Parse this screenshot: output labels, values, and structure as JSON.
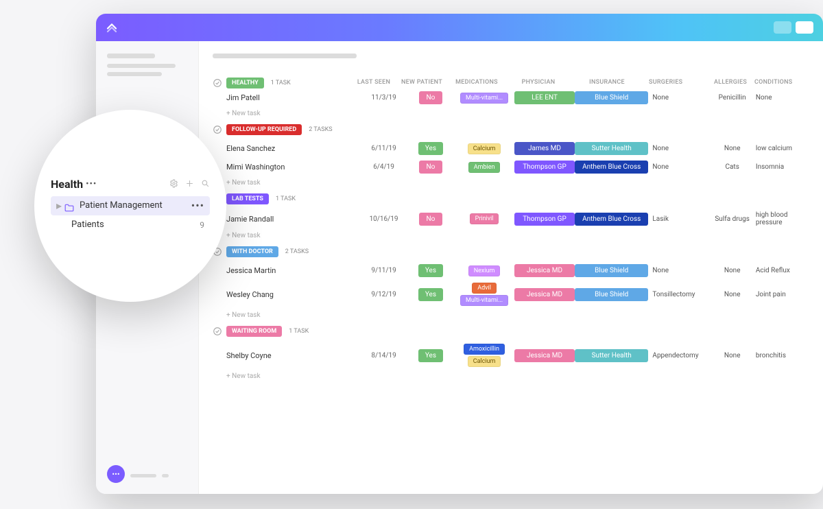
{
  "sidebar_magnifier": {
    "space_title": "Health",
    "folder_label": "Patient Management",
    "list_label": "Patients",
    "list_count": "9"
  },
  "columns": {
    "last_seen": "LAST SEEN",
    "new_patient": "NEW PATIENT",
    "medications": "MEDICATIONS",
    "physician": "PHYSICIAN",
    "insurance": "INSURANCE",
    "surgeries": "SURGERIES",
    "allergies": "ALLERGIES",
    "conditions": "CONDITIONS"
  },
  "labels": {
    "new_task": "+ New task"
  },
  "colors": {
    "new_yes": "#6fbf73",
    "new_no": "#ec7aa6"
  },
  "physician_colors": {
    "LEE ENT": "#6fbf73",
    "James MD": "#4a56c7",
    "Thompson GP": "#7f57ff",
    "Jessica MD": "#ec7aa6"
  },
  "insurance_colors": {
    "Blue Shield": "#5fa8e6",
    "Sutter Health": "#5fc1c7",
    "Anthem Blue Cross": "#1a3fb0"
  },
  "med_colors": {
    "Multi-vitami...": "#b18cff",
    "Calcium": "#f2c94c",
    "Ambien": "#6fbf73",
    "Prinivil": "#ec7aa6",
    "Nexium": "#cf8cff",
    "Advil": "#e86b3a",
    "Amoxicillin": "#2f5fe0"
  },
  "groups": [
    {
      "name": "HEALTHY",
      "color": "#6fbf73",
      "count": "1 TASK",
      "show_header": true,
      "rows": [
        {
          "name": "Jim Patell",
          "last_seen": "11/3/19",
          "new": "No",
          "meds": [
            "Multi-vitami..."
          ],
          "physician": "LEE ENT",
          "insurance": "Blue Shield",
          "surgeries": "None",
          "allergies": "Penicillin",
          "conditions": "None"
        }
      ]
    },
    {
      "name": "FOLLOW-UP REQUIRED",
      "color": "#d92d2d",
      "count": "2 TASKS",
      "rows": [
        {
          "name": "Elena Sanchez",
          "last_seen": "6/11/19",
          "new": "Yes",
          "meds": [
            "Calcium"
          ],
          "physician": "James MD",
          "insurance": "Sutter Health",
          "surgeries": "None",
          "allergies": "None",
          "conditions": "low calcium"
        },
        {
          "name": "Mimi Washington",
          "last_seen": "6/4/19",
          "new": "No",
          "meds": [
            "Ambien"
          ],
          "physician": "Thompson GP",
          "insurance": "Anthem Blue Cross",
          "surgeries": "None",
          "allergies": "Cats",
          "conditions": "Insomnia"
        }
      ]
    },
    {
      "name": "LAB TESTS",
      "color": "#7f57ff",
      "count": "1 TASK",
      "rows": [
        {
          "name": "Jamie Randall",
          "last_seen": "10/16/19",
          "new": "No",
          "meds": [
            "Prinivil"
          ],
          "physician": "Thompson GP",
          "insurance": "Anthem Blue Cross",
          "surgeries": "Lasik",
          "allergies": "Sulfa drugs",
          "conditions": "high blood pressure"
        }
      ]
    },
    {
      "name": "WITH DOCTOR",
      "color": "#5fa8e6",
      "count": "2 TASKS",
      "rows": [
        {
          "name": "Jessica Martin",
          "last_seen": "9/11/19",
          "new": "Yes",
          "meds": [
            "Nexium"
          ],
          "physician": "Jessica MD",
          "insurance": "Blue Shield",
          "surgeries": "None",
          "allergies": "None",
          "conditions": "Acid Reflux"
        },
        {
          "name": "Wesley Chang",
          "last_seen": "9/12/19",
          "new": "Yes",
          "meds": [
            "Advil",
            "Multi-vitami..."
          ],
          "physician": "Jessica MD",
          "insurance": "Blue Shield",
          "surgeries": "Tonsillectomy",
          "allergies": "None",
          "conditions": "Joint pain"
        }
      ]
    },
    {
      "name": "WAITING ROOM",
      "color": "#ec7aa6",
      "count": "1 TASK",
      "rows": [
        {
          "name": "Shelby Coyne",
          "last_seen": "8/14/19",
          "new": "Yes",
          "meds": [
            "Amoxicillin",
            "Calcium"
          ],
          "physician": "Jessica MD",
          "insurance": "Sutter Health",
          "surgeries": "Appendectomy",
          "allergies": "None",
          "conditions": "bronchitis"
        }
      ]
    }
  ]
}
